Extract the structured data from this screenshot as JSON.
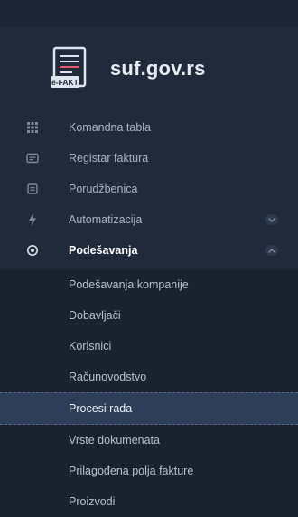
{
  "brand": {
    "name": "suf.gov.rs",
    "logo_caption": "e-FAKT"
  },
  "nav": {
    "items": [
      {
        "icon": "grid-icon",
        "label": "Komandna tabla"
      },
      {
        "icon": "invoice-register-icon",
        "label": "Registar faktura"
      },
      {
        "icon": "order-icon",
        "label": "Porudžbenica"
      },
      {
        "icon": "automation-icon",
        "label": "Automatizacija"
      },
      {
        "icon": "settings-icon",
        "label": "Podešavanja"
      }
    ],
    "settings_submenu": [
      {
        "label": "Podešavanja kompanije"
      },
      {
        "label": "Dobavljači"
      },
      {
        "label": "Korisnici"
      },
      {
        "label": "Računovodstvo"
      },
      {
        "label": "Procesi rada"
      },
      {
        "label": "Vrste dokumenata"
      },
      {
        "label": "Prilagođena polja fakture"
      },
      {
        "label": "Proizvodi"
      }
    ]
  },
  "colors": {
    "sidebar_bg": "#202a3a",
    "submenu_bg": "#1a2230",
    "selected_bg": "#2f3e58",
    "text_muted": "#aab4c3",
    "text_active": "#ffffff"
  }
}
